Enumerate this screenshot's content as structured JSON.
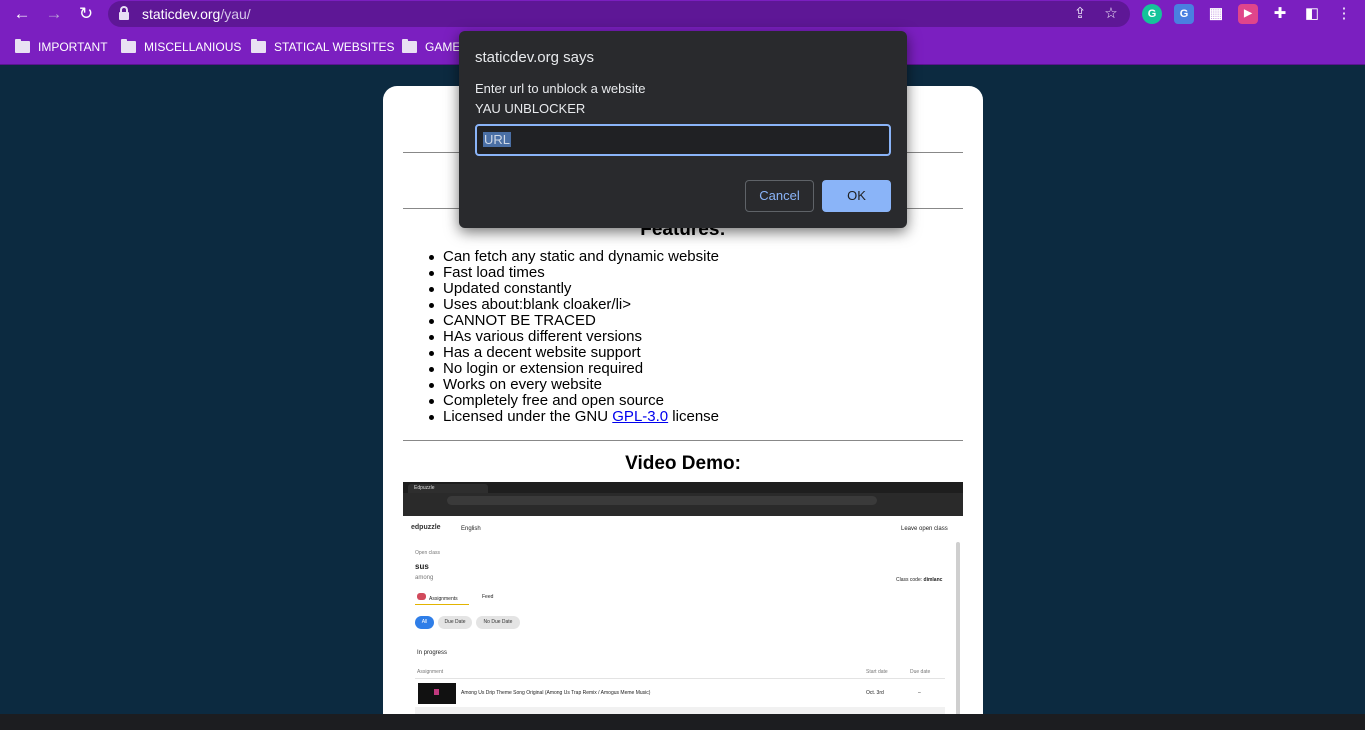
{
  "browser": {
    "url_host": "staticdev.org",
    "url_path": "/yau/",
    "nav": [
      "back-icon",
      "forward-icon",
      "reload-icon"
    ],
    "omnibox_icons": [
      "share-icon",
      "star-icon"
    ],
    "extensions": [
      {
        "name": "grammarly-extension-icon",
        "glyph": "G",
        "color": "#15c39a"
      },
      {
        "name": "translate-extension-icon",
        "glyph": "G",
        "color": "#4a7fe0"
      },
      {
        "name": "qr-code-extension-icon",
        "glyph": "▦",
        "color": "#7b1fc0"
      },
      {
        "name": "video-extension-icon",
        "glyph": "▶",
        "color": "#e0458b"
      }
    ],
    "toolbar_icons": [
      "puzzle-icon",
      "side-panel-icon",
      "kebab-menu-icon"
    ]
  },
  "bookmarks": [
    "IMPORTANT",
    "MISCELLANIOUS",
    "STATICAL WEBSITES",
    "GAMES"
  ],
  "page": {
    "features_title": "Features:",
    "features": [
      "Can fetch any static and dynamic website",
      "Fast load times",
      "Updated constantly",
      "Uses about:blank cloaker/li>",
      "CANNOT BE TRACED",
      "HAs various different versions",
      "Has a decent website support",
      "No login or extension required",
      "Works on every website",
      "Completely free and open source"
    ],
    "license": {
      "prefix": "Licensed under the GNU ",
      "link": "GPL-3.0",
      "suffix": " license"
    },
    "video_title": "Video Demo:",
    "video": {
      "tab": "Edpuzzle",
      "logo": "edpuzzle",
      "language": "English",
      "leave": "Leave open class",
      "open_class_label": "Open class",
      "class_name": "sus",
      "class_sub": "among",
      "class_code_label": "Class code:",
      "class_code": "dimlanc",
      "tab_assignments": "Assignments",
      "tab_feed": "Feed",
      "filter_all": "All",
      "filter_due": "Due Date",
      "filter_no_due": "No Due Date",
      "section": "In progress",
      "col_assignment": "Assignment",
      "col_start": "Start date",
      "col_due": "Due date",
      "row_title": "Among Us Drip Theme Song Original (Among Us Trap Remix / Amogus Meme Music)",
      "row_start": "Oct. 3rd",
      "row_due": "–"
    }
  },
  "dialog": {
    "title": "staticdev.org says",
    "message_line1": "Enter url to unblock a website",
    "message_line2": "YAU UNBLOCKER",
    "input_value": "URL",
    "cancel": "Cancel",
    "ok": "OK",
    "accent": "#8ab4f8"
  }
}
